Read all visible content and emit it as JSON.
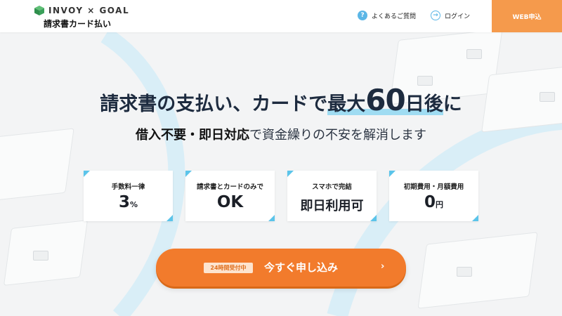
{
  "header": {
    "logo_text": "INVOY × GOAL",
    "logo_sub": "請求書カード払い",
    "faq_label": "よくあるご質問",
    "faq_icon": "?",
    "login_label": "ログイン",
    "login_icon": "→",
    "web_apply_label": "WEB申込"
  },
  "hero": {
    "headline_prefix": "請求書の支払い、カードで",
    "headline_highlight_a": "最大",
    "headline_highlight_num": "60",
    "headline_highlight_b": "日後",
    "headline_suffix": "に",
    "sub_bold": "借入不要・即日対応",
    "sub_rest": "で資金繰りの不安を解消します"
  },
  "features": [
    {
      "title": "手数料一律",
      "value": "3",
      "unit": "%"
    },
    {
      "title": "請求書とカードのみで",
      "value": "OK",
      "unit": ""
    },
    {
      "title": "スマホで完結",
      "value": "即日利用可",
      "unit": ""
    },
    {
      "title": "初期費用・月額費用",
      "value": "0",
      "unit": "円"
    }
  ],
  "cta": {
    "badge": "24時間受付中",
    "label": "今すぐ申し込み",
    "arrow": "›"
  },
  "colors": {
    "accent_orange": "#f27b2c",
    "header_button": "#f59a4c",
    "highlight_blue": "#9fdcf2",
    "corner_blue": "#5bc4ea",
    "logo_green": "#3aa05a"
  }
}
